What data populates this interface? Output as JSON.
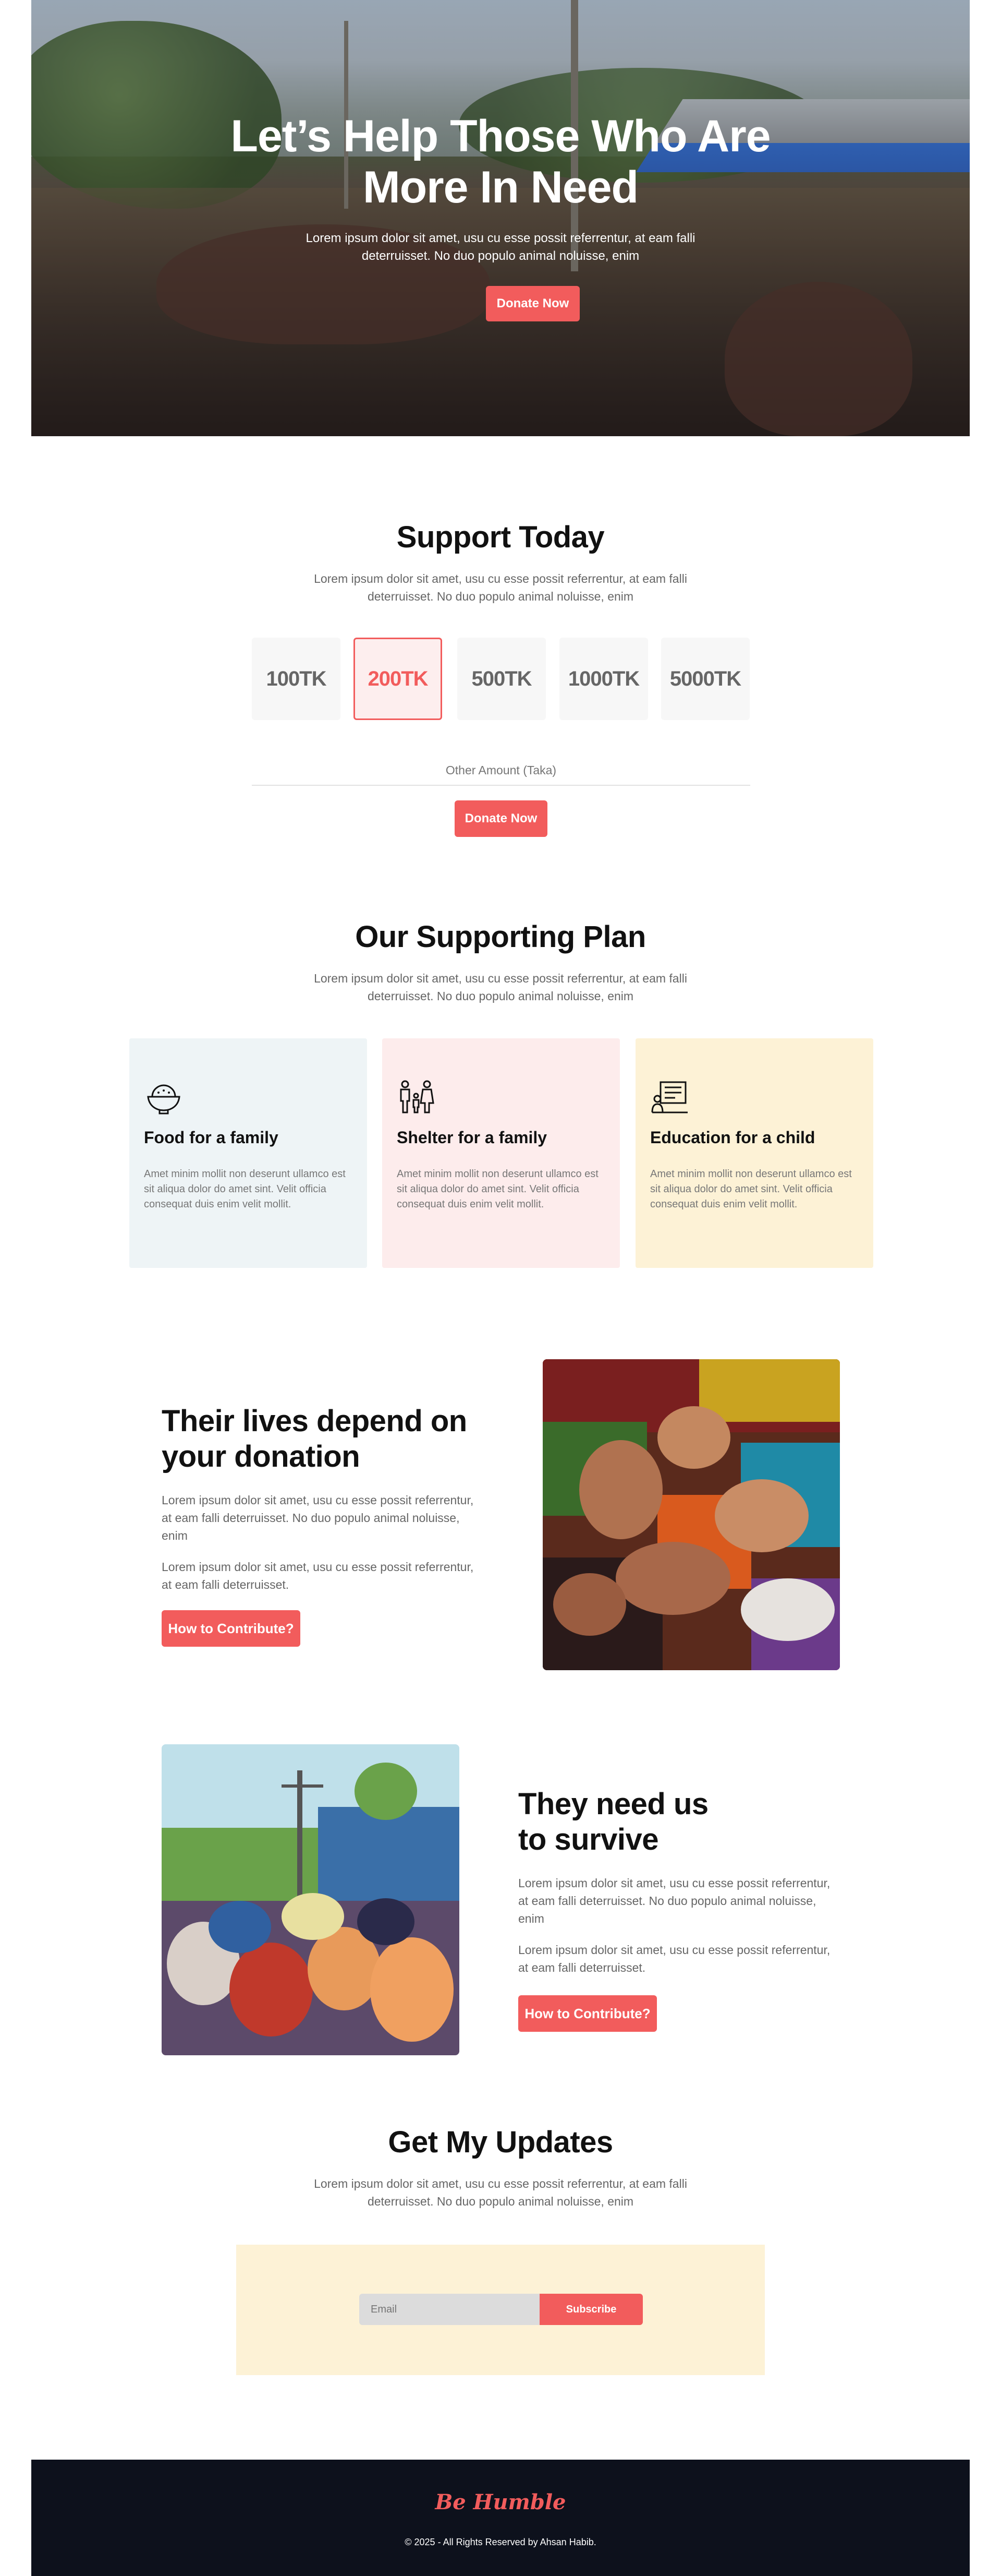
{
  "hero": {
    "title_line1": "Let’s Help Those Who Are",
    "title_line2": "More In Need",
    "subtitle_line1": "Lorem ipsum dolor sit amet, usu cu esse possit referrentur, at eam falli",
    "subtitle_line2": "deterruisset. No duo populo animal noluisse, enim",
    "button": "Donate Now"
  },
  "support": {
    "title": "Support Today",
    "subtitle_line1": "Lorem ipsum dolor sit amet, usu cu esse possit referrentur, at eam falli",
    "subtitle_line2": "deterruisset. No duo populo animal noluisse, enim",
    "amounts": [
      "100TK",
      "200TK",
      "500TK",
      "1000TK",
      "5000TK"
    ],
    "selected_amount": "200TK",
    "other_placeholder": "Other Amount (Taka)",
    "button": "Donate Now"
  },
  "plan": {
    "title": "Our Supporting Plan",
    "subtitle_line1": "Lorem ipsum dolor sit amet, usu cu esse possit referrentur, at eam falli",
    "subtitle_line2": "deterruisset. No duo populo animal noluisse, enim",
    "cards": [
      {
        "title": "Food for a family",
        "text": "Amet minim mollit non deserunt ullamco est sit aliqua dolor do amet sint. Velit officia consequat duis enim velit mollit.",
        "icon": "food-bowl-icon",
        "bg": "#eef4f6"
      },
      {
        "title": "Shelter for a family",
        "text": "Amet minim mollit non deserunt ullamco est sit aliqua dolor do amet sint. Velit officia consequat duis enim velit mollit.",
        "icon": "family-icon",
        "bg": "#fdecec"
      },
      {
        "title": "Education for a child",
        "text": "Amet minim mollit non deserunt ullamco est sit aliqua dolor do amet sint. Velit officia consequat duis enim velit mollit.",
        "icon": "education-icon",
        "bg": "#fdf2d6"
      }
    ]
  },
  "lives": {
    "title_line1": "Their lives depend on",
    "title_line2": "your donation",
    "para1": "Lorem ipsum dolor sit amet, usu cu esse possit referrentur, at eam falli deterruisset. No duo populo animal noluisse, enim",
    "para2": "Lorem ipsum dolor sit amet, usu cu esse possit referrentur, at eam falli deterruisset.",
    "button": "How to Contribute?"
  },
  "survive": {
    "title_line1": "They need us",
    "title_line2": "to survive",
    "para1": "Lorem ipsum dolor sit amet, usu cu esse possit referrentur, at eam falli deterruisset. No duo populo animal noluisse, enim",
    "para2": "Lorem ipsum dolor sit amet, usu cu esse possit referrentur, at eam falli deterruisset.",
    "button": "How to Contribute?"
  },
  "updates": {
    "title": "Get My Updates",
    "subtitle_line1": "Lorem ipsum dolor sit amet, usu cu esse possit referrentur, at eam falli",
    "subtitle_line2": "deterruisset. No duo populo animal noluisse, enim",
    "email_placeholder": "Email",
    "button": "Subscribe"
  },
  "footer": {
    "brand": "Be Humble",
    "copyright": "© 2025 - All Rights Reserved by Ahsan Habib."
  },
  "colors": {
    "accent": "#f25c5c",
    "footer_bg": "#0d111c"
  }
}
